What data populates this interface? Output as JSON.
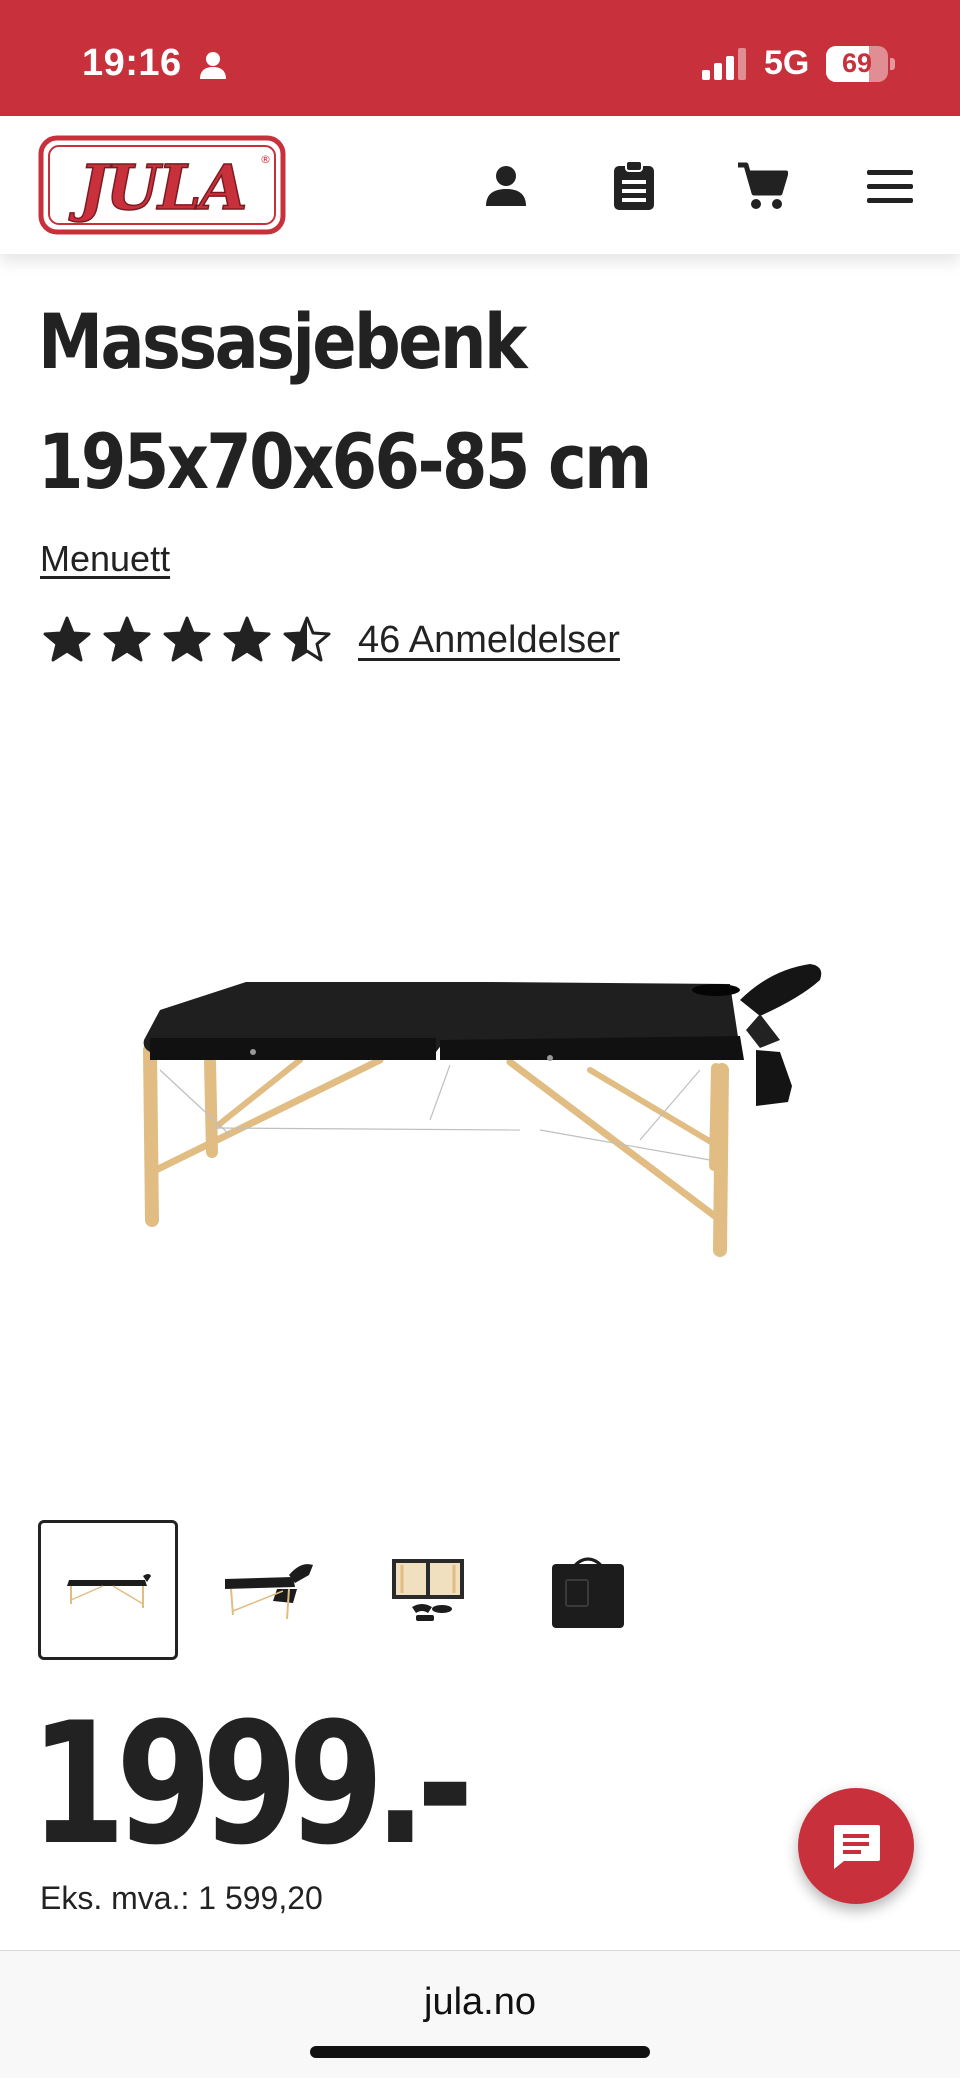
{
  "status_bar": {
    "time": "19:16",
    "network": "5G",
    "battery": "69",
    "battery_level": 0.69,
    "icons": [
      "person-icon",
      "signal-icon",
      "battery-icon"
    ]
  },
  "header": {
    "logo_text": "JULA",
    "icons": [
      "account-icon",
      "shopping-list-icon",
      "cart-icon",
      "menu-icon"
    ]
  },
  "product": {
    "title_line1": "Massasjebenk",
    "title_line2": "195x70x66-85 cm",
    "brand": "Menuett",
    "rating": 4.5,
    "rating_max": 5,
    "reviews": "46 Anmeldelser",
    "thumbnails_count": 4,
    "active_thumbnail": 1,
    "price": "1999.-",
    "vat_note": "Eks. mva.: 1 599,20"
  },
  "chat": {
    "icon": "chat-icon"
  },
  "browser": {
    "url": "jula.no"
  },
  "colors": {
    "brand_red": "#c8313c",
    "text": "#222222",
    "wood": "#e6c48a"
  }
}
